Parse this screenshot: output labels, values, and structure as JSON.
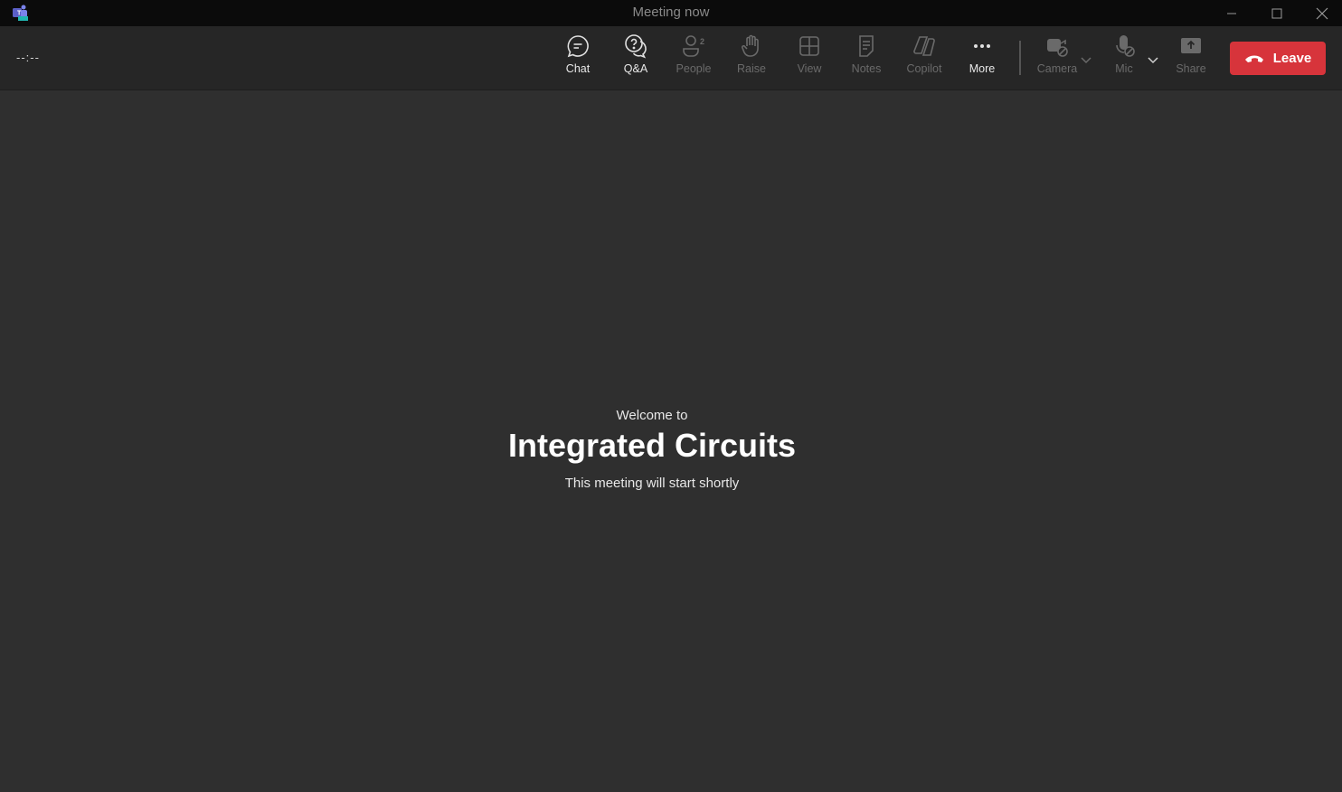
{
  "window": {
    "title": "Meeting now",
    "controls": [
      "minimize",
      "maximize",
      "close"
    ]
  },
  "toolbar": {
    "timer": "--:--",
    "buttons": [
      {
        "id": "chat",
        "label": "Chat",
        "icon": "chat-icon",
        "enabled": true
      },
      {
        "id": "qa",
        "label": "Q&A",
        "icon": "qa-icon",
        "enabled": true
      },
      {
        "id": "people",
        "label": "People",
        "icon": "people-icon",
        "count": "2",
        "enabled": false
      },
      {
        "id": "raise",
        "label": "Raise",
        "icon": "hand-icon",
        "enabled": false
      },
      {
        "id": "view",
        "label": "View",
        "icon": "grid-icon",
        "enabled": false
      },
      {
        "id": "notes",
        "label": "Notes",
        "icon": "notes-icon",
        "enabled": false
      },
      {
        "id": "copilot",
        "label": "Copilot",
        "icon": "copilot-icon",
        "enabled": false
      },
      {
        "id": "more",
        "label": "More",
        "icon": "ellipsis-icon",
        "enabled": true
      },
      {
        "id": "camera",
        "label": "Camera",
        "icon": "camera-off-icon",
        "enabled": false
      },
      {
        "id": "mic",
        "label": "Mic",
        "icon": "mic-off-icon",
        "enabled": false
      },
      {
        "id": "share",
        "label": "Share",
        "icon": "share-icon",
        "enabled": false
      }
    ],
    "leave_label": "Leave",
    "leave_color": "#d7343b"
  },
  "stage": {
    "welcome": "Welcome to",
    "meeting_name": "Integrated Circuits",
    "status": "This meeting will start shortly"
  }
}
